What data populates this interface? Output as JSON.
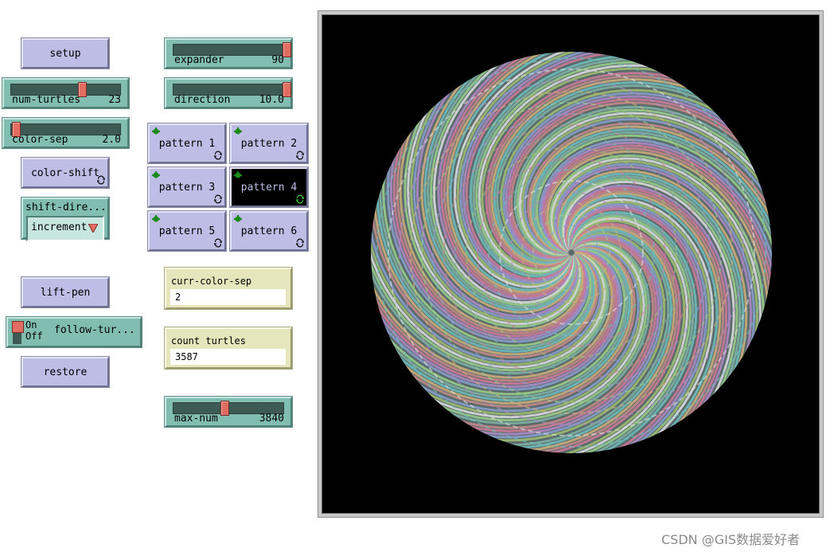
{
  "buttons": {
    "setup": "setup",
    "color_shift": "color-shift",
    "lift_pen": "lift-pen",
    "restore": "restore",
    "pattern1": "pattern 1",
    "pattern2": "pattern 2",
    "pattern3": "pattern 3",
    "pattern4": "pattern 4",
    "pattern5": "pattern 5",
    "pattern6": "pattern 6"
  },
  "sliders": {
    "num_turtles": {
      "label": "num-turtles",
      "value": "23"
    },
    "color_sep": {
      "label": "color-sep",
      "value": "2.0"
    },
    "expander": {
      "label": "expander",
      "value": "90"
    },
    "direction": {
      "label": "direction",
      "value": "10.0"
    },
    "max_num": {
      "label": "max-num",
      "value": "3840"
    }
  },
  "chooser": {
    "title": "shift-dire...",
    "selected": "increment",
    "arrow": "▼"
  },
  "switch": {
    "on": "On",
    "off": "Off",
    "name": "follow-tur..."
  },
  "monitors": {
    "curr_color_sep": {
      "title": "curr-color-sep",
      "value": "2"
    },
    "count_turtles": {
      "title": "count turtles",
      "value": "3587"
    }
  },
  "colors": {
    "button_bg": "#bdbde6",
    "slider_bg": "#82bdb1",
    "monitor_bg": "#e6e6bd",
    "thumb": "#e26d62",
    "view_bg": "#000000"
  },
  "icons": {
    "forever": "forever-arrows-icon",
    "agent": "turtle-agent-icon"
  },
  "watermark": "CSDN @GIS数据爱好者"
}
